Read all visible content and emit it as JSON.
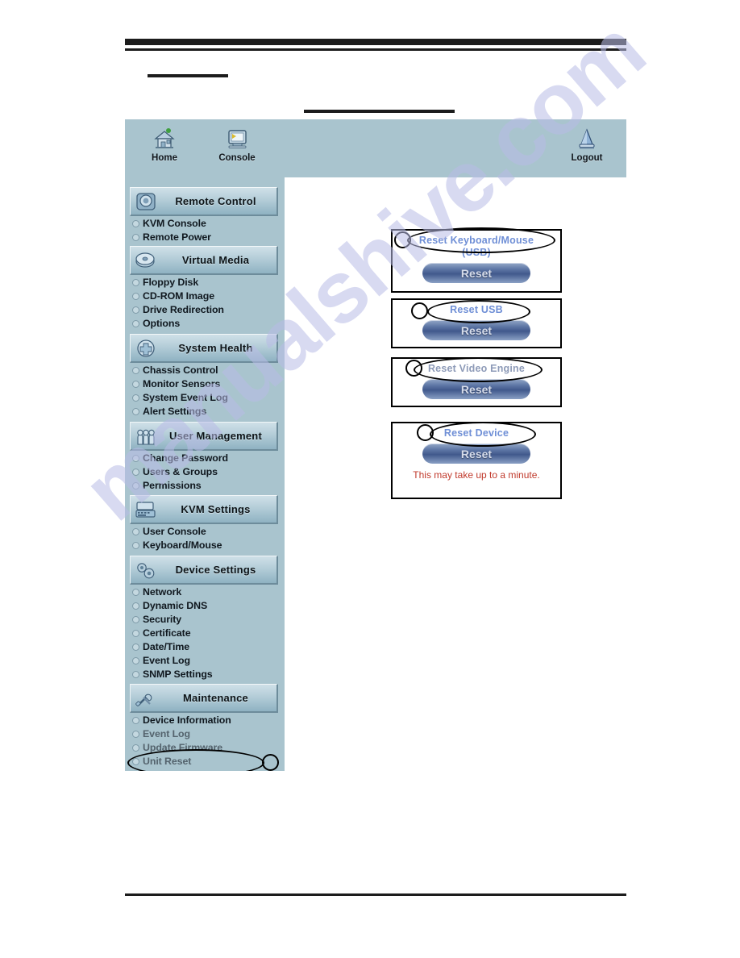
{
  "page": {
    "redactions": [
      "header-bar",
      "header-rule",
      "subtitle-bar",
      "section-title-bar"
    ],
    "watermark": "manualshive.com",
    "footer_rule": true
  },
  "ui": {
    "toolbar": [
      {
        "label": "Home",
        "icon": "home-icon"
      },
      {
        "label": "Console",
        "icon": "console-monitor-icon"
      },
      {
        "label": "Logout",
        "icon": "logout-icon"
      }
    ],
    "nav": [
      {
        "title": "Remote Control",
        "icon": "remote-control-icon",
        "items": [
          "KVM Console",
          "Remote Power"
        ]
      },
      {
        "title": "Virtual Media",
        "icon": "virtual-media-disc-icon",
        "items": [
          "Floppy Disk",
          "CD-ROM Image",
          "Drive Redirection",
          "Options"
        ]
      },
      {
        "title": "System Health",
        "icon": "system-health-icon",
        "items": [
          "Chassis Control",
          "Monitor Sensors",
          "System Event Log",
          "Alert Settings"
        ]
      },
      {
        "title": "User Management",
        "icon": "user-management-icon",
        "items": [
          "Change Password",
          "Users & Groups",
          "Permissions"
        ]
      },
      {
        "title": "KVM Settings",
        "icon": "kvm-settings-keyboard-icon",
        "items": [
          "User Console",
          "Keyboard/Mouse"
        ]
      },
      {
        "title": "Device Settings",
        "icon": "device-settings-gears-icon",
        "items": [
          "Network",
          "Dynamic DNS",
          "Security",
          "Certificate",
          "Date/Time",
          "Event Log",
          "SNMP Settings"
        ]
      },
      {
        "title": "Maintenance",
        "icon": "maintenance-tools-icon",
        "items": [
          "Device Information",
          "Event Log",
          "Update Firmware",
          "Unit Reset"
        ]
      }
    ],
    "reset_panels": [
      {
        "title": "Reset Keyboard/Mouse",
        "title2": "(USB)",
        "button": "Reset",
        "note": ""
      },
      {
        "title": "Reset USB",
        "title2": "",
        "button": "Reset",
        "note": ""
      },
      {
        "title": "Reset Video Engine",
        "title2": "",
        "button": "Reset",
        "note": ""
      },
      {
        "title": "Reset Device",
        "title2": "",
        "button": "Reset",
        "note": "This may take up to a minute."
      }
    ],
    "annotations": {
      "callout_markers": 5,
      "ellipse_highlights": [
        "Reset Keyboard/Mouse",
        "Reset USB",
        "Reset Video Engine",
        "Reset Device",
        "Unit Reset"
      ]
    },
    "colors": {
      "chrome": "#a9c4ce",
      "nav_header": "#b4cdd8",
      "link_blue": "#6f8fd6",
      "warning_red": "#c0392b",
      "annotation": "#000000",
      "watermark": "#b9bce6"
    }
  }
}
